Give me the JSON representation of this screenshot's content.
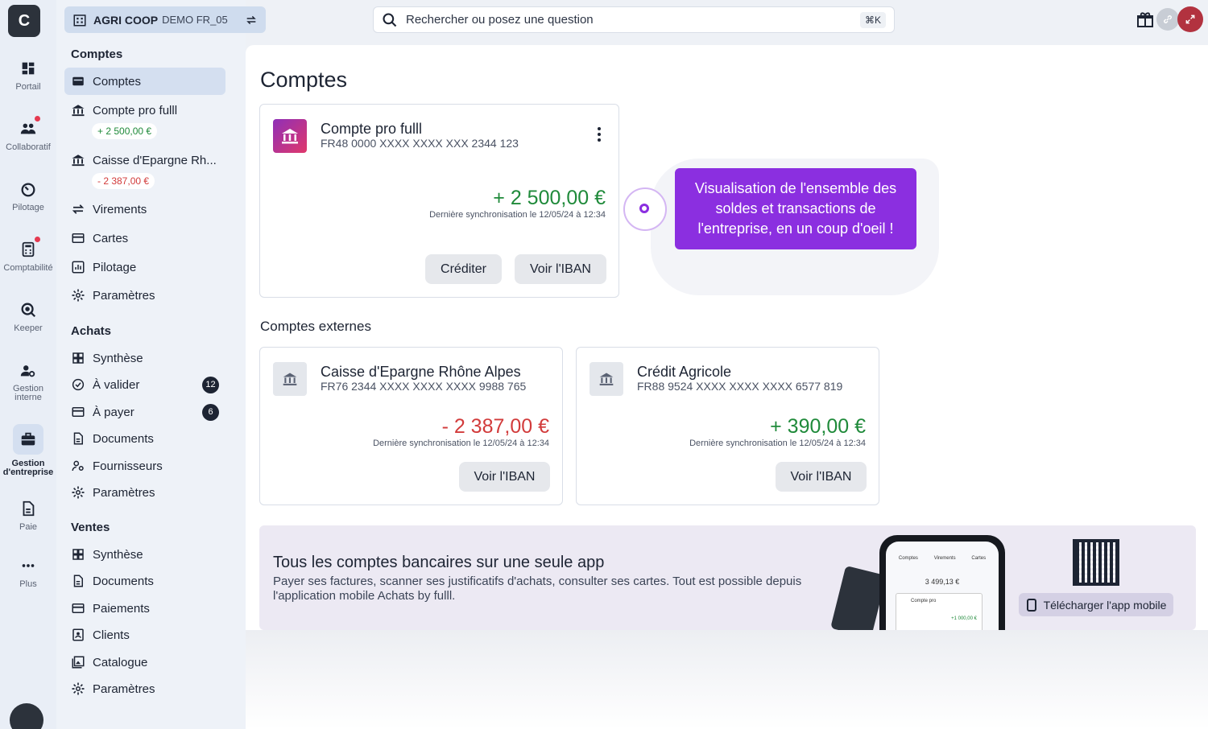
{
  "app": {
    "logo_text": "C"
  },
  "rail": [
    {
      "label": "Portail"
    },
    {
      "label": "Collaboratif"
    },
    {
      "label": "Pilotage"
    },
    {
      "label": "Comptabilité"
    },
    {
      "label": "Keeper"
    },
    {
      "label": "Gestion interne"
    },
    {
      "label": "Gestion d'entreprise"
    },
    {
      "label": "Paie"
    },
    {
      "label": "Plus"
    }
  ],
  "org": {
    "name": "AGRI COOP",
    "suffix": "DEMO FR_05"
  },
  "search": {
    "placeholder": "Rechercher ou posez une question",
    "shortcut": "⌘K"
  },
  "sidebar": {
    "comptes_title": "Comptes",
    "comptes_items": [
      {
        "label": "Comptes"
      },
      {
        "label": "Compte pro fulll",
        "amount": "+ 2 500,00 €"
      },
      {
        "label": "Caisse d'Epargne Rh...",
        "amount": "- 2 387,00 €"
      },
      {
        "label": "Virements"
      },
      {
        "label": "Cartes"
      },
      {
        "label": "Pilotage"
      },
      {
        "label": "Paramètres"
      }
    ],
    "achats_title": "Achats",
    "achats_items": [
      {
        "label": "Synthèse"
      },
      {
        "label": "À valider",
        "badge": "12"
      },
      {
        "label": "À payer",
        "badge": "6"
      },
      {
        "label": "Documents"
      },
      {
        "label": "Fournisseurs"
      },
      {
        "label": "Paramètres"
      }
    ],
    "ventes_title": "Ventes",
    "ventes_items": [
      {
        "label": "Synthèse"
      },
      {
        "label": "Documents"
      },
      {
        "label": "Paiements"
      },
      {
        "label": "Clients"
      },
      {
        "label": "Catalogue"
      },
      {
        "label": "Paramètres"
      }
    ]
  },
  "main": {
    "title": "Comptes",
    "pro_account": {
      "title": "Compte pro fulll",
      "iban": "FR48 0000 XXXX XXXX XXX 2344 123",
      "amount": "+ 2 500,00 €",
      "sync": "Dernière synchronisation le 12/05/24 à 12:34",
      "credit_label": "Créditer",
      "iban_label": "Voir l'IBAN"
    },
    "tooltip": "Visualisation de l'ensemble des soldes et transactions de l'entreprise, en un coup d'oeil !",
    "external_title": "Comptes externes",
    "external": [
      {
        "title": "Caisse d'Epargne Rhône Alpes",
        "iban": "FR76 2344 XXXX XXXX XXXX 9988 765",
        "amount": "- 2 387,00 €",
        "sync": "Dernière synchronisation le 12/05/24 à 12:34",
        "iban_label": "Voir l'IBAN"
      },
      {
        "title": "Crédit Agricole",
        "iban": "FR88 9524 XXXX XXXX XXXX 6577 819",
        "amount": "+ 390,00 €",
        "sync": "Dernière synchronisation le 12/05/24 à 12:34",
        "iban_label": "Voir l'IBAN"
      }
    ],
    "banner": {
      "title": "Tous les comptes bancaires sur une seule app",
      "text": "Payer ses factures, scanner ses justificatifs d'achats, consulter ses cartes. Tout est possible depuis l'application mobile Achats by fulll.",
      "download_label": "Télécharger l'app mobile",
      "phone_tabs": [
        "Comptes",
        "Virements",
        "Cartes"
      ],
      "phone_balance": "3 499,13 €",
      "phone_account": "Compte pro",
      "phone_amount": "+1 000,00 €"
    }
  },
  "colors": {
    "accent": "#8b2fe0",
    "positive": "#1f8a3a",
    "negative": "#d23b3b"
  }
}
